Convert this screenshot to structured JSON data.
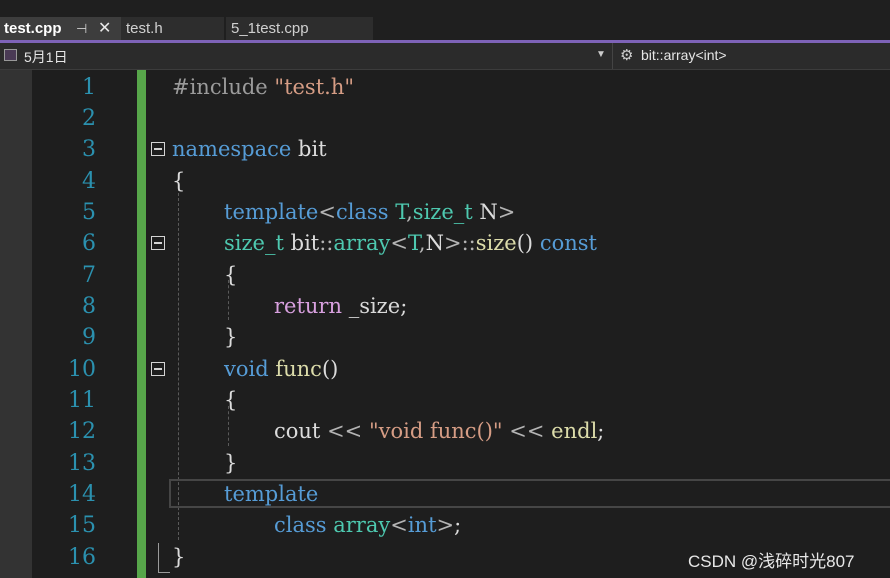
{
  "tabs": [
    {
      "label": "test.cpp",
      "active": true
    },
    {
      "label": "test.h",
      "active": false
    },
    {
      "label": "5_1test.cpp",
      "active": false
    }
  ],
  "tab_controls": {
    "pin_icon": "pin-icon",
    "close_icon": "close-icon"
  },
  "navbar": {
    "scope_left": "5月1日",
    "scope_right": "bit::array<int>"
  },
  "line_numbers": [
    "1",
    "2",
    "3",
    "4",
    "5",
    "6",
    "7",
    "8",
    "9",
    "10",
    "11",
    "12",
    "13",
    "14",
    "15",
    "16"
  ],
  "code": {
    "l1": {
      "pp": "#include",
      "str": "\"test.h\""
    },
    "l3": {
      "kw": "namespace",
      "name": "bit"
    },
    "l4": {
      "brace": "{"
    },
    "l5": {
      "kw": "template",
      "lt": "<",
      "kw2": "class",
      "t": "T",
      "comma": ",",
      "ty": "size_t",
      "n": "N",
      "gt": ">"
    },
    "l6": {
      "ty": "size_t",
      "ns": "bit",
      "sep1": "::",
      "ty2": "array",
      "lt": "<",
      "t": "T",
      "comma": ",",
      "n": "N",
      "gt": ">",
      "sep2": "::",
      "fn": "size",
      "parens": "()",
      "kw": "const"
    },
    "l7": {
      "brace": "{"
    },
    "l8": {
      "ctl": "return",
      "var": "_size",
      "semi": ";"
    },
    "l9": {
      "brace": "}"
    },
    "l10": {
      "kw": "void",
      "fn": "func",
      "parens": "()"
    },
    "l11": {
      "brace": "{"
    },
    "l12": {
      "id": "cout",
      "op1": "<<",
      "str": "\"void func()\"",
      "op2": "<<",
      "id2": "endl",
      "semi": ";"
    },
    "l13": {
      "brace": "}"
    },
    "l14": {
      "kw": "template"
    },
    "l15": {
      "kw": "class",
      "ty": "array",
      "lt": "<",
      "kw2": "int",
      "gt": ">",
      "semi": ";"
    },
    "l16": {
      "brace": "}"
    }
  },
  "colors": {
    "keyword": "#569cd6",
    "type": "#4ec9b0",
    "function": "#dcdcaa",
    "control": "#d8a0df",
    "string": "#d69d85",
    "preprocessor": "#9b9b9b",
    "line_number": "#2b91af",
    "change_bar": "#57a64a",
    "tab_underline": "#7e63b8"
  },
  "watermark": "CSDN @浅碎时光807"
}
